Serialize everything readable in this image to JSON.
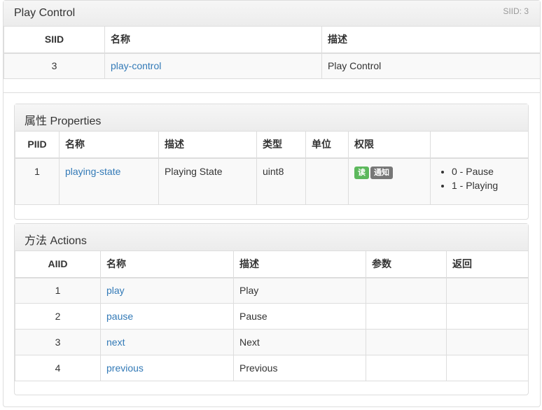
{
  "service": {
    "title": "Play Control",
    "siid_tag": "SIID: 3",
    "columns": [
      "SIID",
      "名称",
      "描述"
    ],
    "row": {
      "siid": "3",
      "name": "play-control",
      "description": "Play Control"
    }
  },
  "properties": {
    "title": "属性 Properties",
    "columns": [
      "PIID",
      "名称",
      "描述",
      "类型",
      "单位",
      "权限",
      ""
    ],
    "rows": [
      {
        "piid": "1",
        "name": "playing-state",
        "description": "Playing State",
        "type": "uint8",
        "unit": "",
        "access": [
          "读",
          "通知"
        ],
        "values": [
          "0 - Pause",
          "1 - Playing"
        ]
      }
    ]
  },
  "actions": {
    "title": "方法 Actions",
    "columns": [
      "AIID",
      "名称",
      "描述",
      "参数",
      "返回"
    ],
    "rows": [
      {
        "aiid": "1",
        "name": "play",
        "description": "Play",
        "params": "",
        "returns": ""
      },
      {
        "aiid": "2",
        "name": "pause",
        "description": "Pause",
        "params": "",
        "returns": ""
      },
      {
        "aiid": "3",
        "name": "next",
        "description": "Next",
        "params": "",
        "returns": ""
      },
      {
        "aiid": "4",
        "name": "previous",
        "description": "Previous",
        "params": "",
        "returns": ""
      }
    ]
  },
  "colors": {
    "link": "#337ab7",
    "read_badge": "#5cb85c",
    "notify_badge": "#777777",
    "border": "#dddddd"
  }
}
